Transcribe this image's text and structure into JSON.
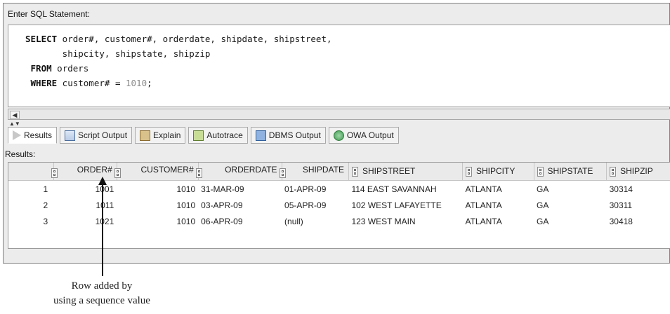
{
  "editor": {
    "label": "Enter SQL Statement:",
    "lines": [
      {
        "kw": "SELECT",
        "text": " order#, customer#, orderdate, shipdate, shipstreet,"
      },
      {
        "kw": "",
        "text": "       shipcity, shipstate, shipzip"
      },
      {
        "kw": " FROM",
        "text": " orders"
      },
      {
        "kw": " WHERE",
        "text": " customer# = ",
        "num": "1010",
        "tail": ";"
      }
    ]
  },
  "tabs": [
    {
      "label": "Results",
      "icon": "results-icon",
      "active": true
    },
    {
      "label": "Script Output",
      "icon": "script-output-icon"
    },
    {
      "label": "Explain",
      "icon": "explain-icon"
    },
    {
      "label": "Autotrace",
      "icon": "autotrace-icon"
    },
    {
      "label": "DBMS Output",
      "icon": "dbms-output-icon"
    },
    {
      "label": "OWA Output",
      "icon": "owa-output-icon"
    }
  ],
  "results": {
    "label": "Results:",
    "columns": [
      "ORDER#",
      "CUSTOMER#",
      "ORDERDATE",
      "SHIPDATE",
      "SHIPSTREET",
      "SHIPCITY",
      "SHIPSTATE",
      "SHIPZIP"
    ],
    "rows": [
      {
        "n": "1",
        "cells": [
          "1001",
          "1010",
          "31-MAR-09",
          "01-APR-09",
          "114 EAST SAVANNAH",
          "ATLANTA",
          "GA",
          "30314"
        ]
      },
      {
        "n": "2",
        "cells": [
          "1011",
          "1010",
          "03-APR-09",
          "05-APR-09",
          "102 WEST LAFAYETTE",
          "ATLANTA",
          "GA",
          "30311"
        ]
      },
      {
        "n": "3",
        "cells": [
          "1021",
          "1010",
          "06-APR-09",
          "(null)",
          "123 WEST MAIN",
          "ATLANTA",
          "GA",
          "30418"
        ]
      }
    ]
  },
  "annotation": {
    "line1": "Row added by",
    "line2": "using a sequence value"
  }
}
